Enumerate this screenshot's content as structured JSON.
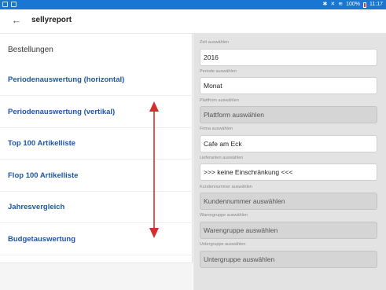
{
  "statusbar": {
    "battery_text": "100%",
    "time": "11:17",
    "icons": [
      "bluetooth-icon",
      "mute-icon",
      "wifi-icon",
      "battery-icon"
    ]
  },
  "appbar": {
    "title": "sellyreport",
    "back_icon": "arrow-left-icon"
  },
  "left": {
    "section_title": "Bestellungen",
    "items": [
      {
        "label": "Periodenauswertung (horizontal)"
      },
      {
        "label": "Periodenauswertung (vertikal)"
      },
      {
        "label": "Top 100 Artikelliste"
      },
      {
        "label": "Flop 100 Artikelliste"
      },
      {
        "label": "Jahresvergleich"
      },
      {
        "label": "Budgetauswertung"
      }
    ]
  },
  "annotation": {
    "color": "#d32f2f",
    "type": "double-arrow-vertical"
  },
  "right": {
    "fields": [
      {
        "label": "Zeit auswählen",
        "value": "2016",
        "state": "active"
      },
      {
        "label": "Periode auswählen",
        "value": "Monat",
        "state": "active"
      },
      {
        "label": "Plattform auswählen",
        "value": "Plattform auswählen",
        "state": "disabled"
      },
      {
        "label": "Firma auswählen",
        "value": "Cafe am Eck",
        "state": "active"
      },
      {
        "label": "Lieferanten auswählen",
        "value": ">>> keine Einschränkung <<<",
        "state": "active"
      },
      {
        "label": "Kundennummer auswählen",
        "value": "Kundennummer auswählen",
        "state": "disabled"
      },
      {
        "label": "Warengruppe auswählen",
        "value": "Warengruppe auswählen",
        "state": "disabled"
      },
      {
        "label": "Untergruppe auswählen",
        "value": "Untergruppe auswählen",
        "state": "disabled"
      }
    ]
  },
  "colors": {
    "statusbar": "#1976d2",
    "link": "#1d56a8",
    "panel": "#e3e3e3",
    "arrow": "#d32f2f"
  }
}
